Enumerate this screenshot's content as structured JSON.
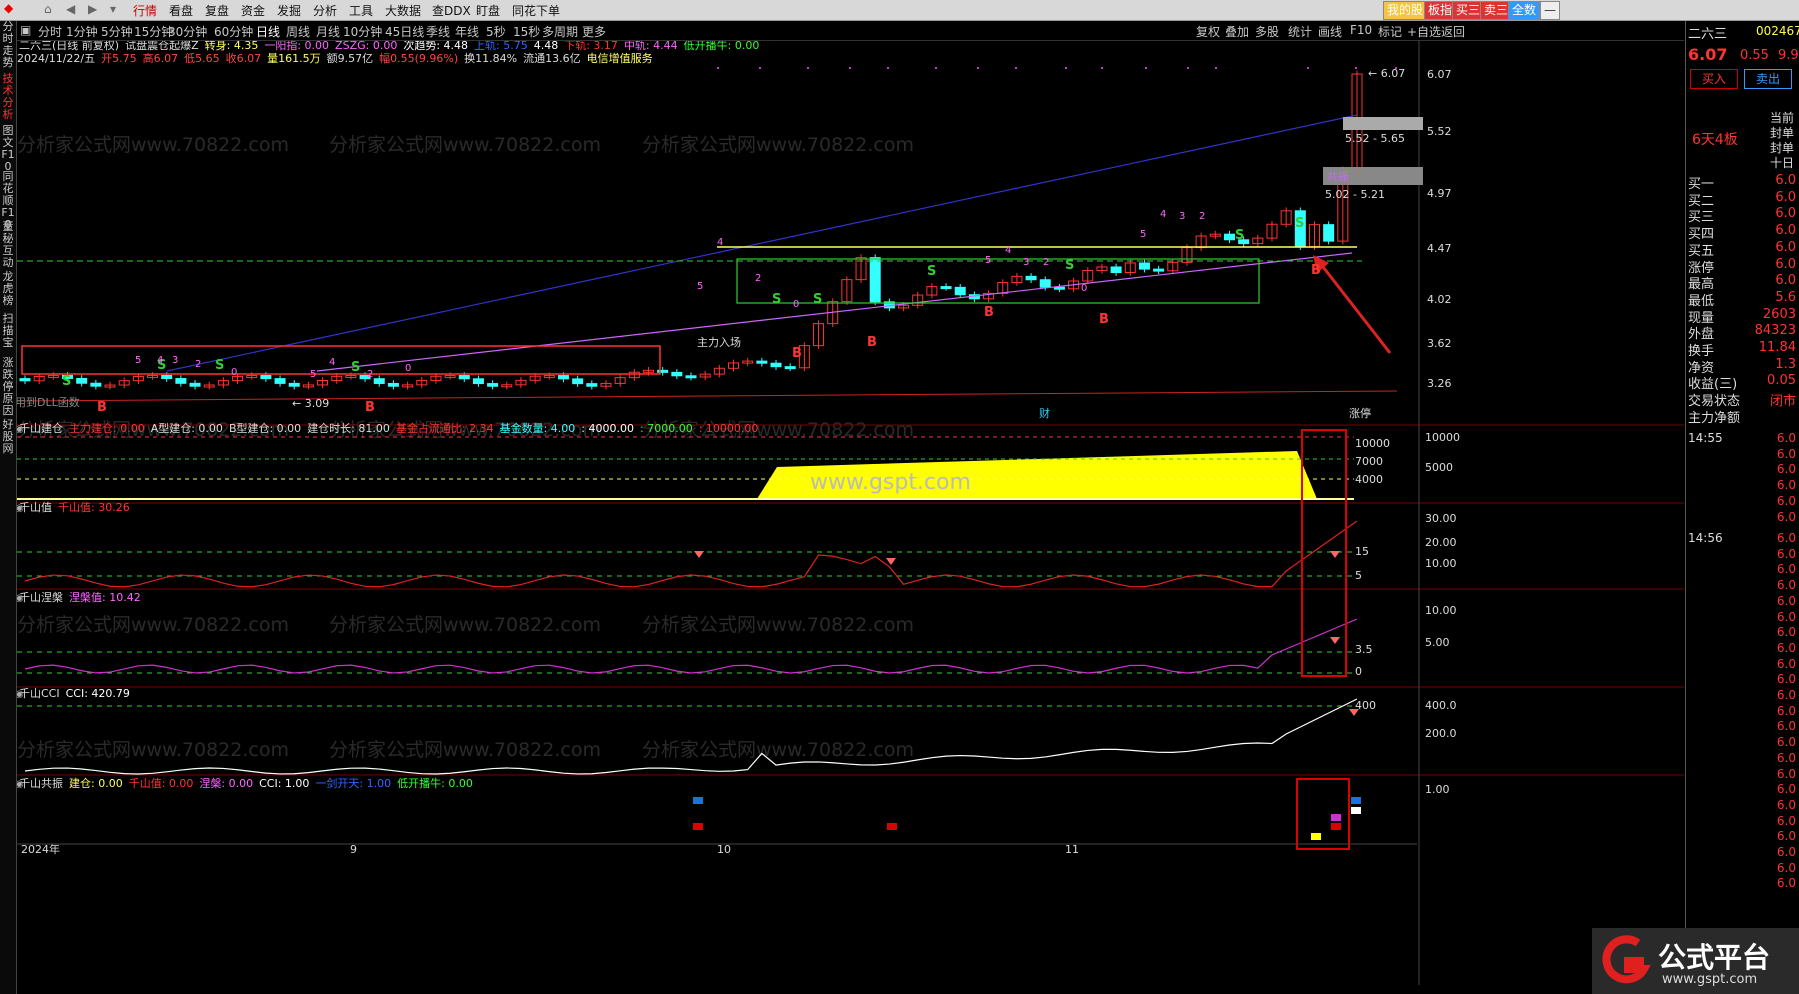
{
  "toolbar": {
    "items": [
      "行情",
      "看盘",
      "复盘",
      "资金",
      "发掘",
      "分析",
      "工具",
      "大数据",
      "查DDX",
      "盯盘",
      "同花下单"
    ],
    "active_index": 0,
    "right_buttons": [
      "我的股",
      "板指",
      "买三",
      "卖三",
      "全数"
    ]
  },
  "periods": {
    "items": [
      "分时",
      "1分钟",
      "5分钟",
      "15分钟",
      "30分钟",
      "60分钟",
      "日线",
      "周线",
      "月线",
      "10分钟",
      "45日线",
      "季线",
      "年线",
      "5秒",
      "15秒",
      "多周期",
      "更多"
    ],
    "active_index": 6,
    "right_tools": [
      "复权",
      "叠加",
      "多股",
      "统计",
      "画线",
      "F10",
      "标记",
      "+自选",
      "返回"
    ]
  },
  "leftbar": [
    "分时走势",
    "技术分析",
    "图文F10",
    "同花顺F10",
    "董秘互动",
    "龙虎榜",
    "扫描宝",
    "涨跌停原因",
    "好股网"
  ],
  "leftbar_active": 1,
  "stock": {
    "name": "二六三",
    "code": "002467",
    "price": "6.07",
    "change": "0.55",
    "change_pct": "9.9",
    "buy_label": "买入",
    "sell_label": "卖出"
  },
  "main_header": {
    "line1": [
      {
        "t": "二六三(日线 前复权)",
        "c": "#dddddd"
      },
      {
        "t": "试盘震仓起爆Z",
        "c": "#dddddd"
      },
      {
        "t": "转身: 4.35",
        "c": "#ffff66"
      },
      {
        "t": "一阳指: 0.00",
        "c": "#ff66ff"
      },
      {
        "t": "ZSZG: 0.00",
        "c": "#ff66ff"
      },
      {
        "t": "次趋势: 4.48",
        "c": "#ffffff"
      },
      {
        "t": "上轨: 5.75",
        "c": "#3366ff"
      },
      {
        "t": "4.48",
        "c": "#ffffff"
      },
      {
        "t": "下轨: 3.17",
        "c": "#ff3333"
      },
      {
        "t": "中轨: 4.44",
        "c": "#ff66ff"
      },
      {
        "t": "低开播牛: 0.00",
        "c": "#33ff33"
      }
    ],
    "line2": [
      {
        "t": "2024/11/22/五",
        "c": "#dddddd"
      },
      {
        "t": "开5.75",
        "c": "#ff4444"
      },
      {
        "t": "高6.07",
        "c": "#ff4444"
      },
      {
        "t": "低5.65",
        "c": "#ff4444"
      },
      {
        "t": "收6.07",
        "c": "#ff4444"
      },
      {
        "t": "量161.5万",
        "c": "#ffff66"
      },
      {
        "t": "额9.57亿",
        "c": "#dddddd"
      },
      {
        "t": "幅0.55(9.96%)",
        "c": "#ff4444"
      },
      {
        "t": "换11.84%",
        "c": "#dddddd"
      },
      {
        "t": "流通13.6亿",
        "c": "#dddddd"
      },
      {
        "t": "电信增值服务",
        "c": "#ffff66"
      }
    ]
  },
  "price_axis": [
    "6.07",
    "5.52",
    "4.97",
    "4.47",
    "4.02",
    "3.62",
    "3.26"
  ],
  "annotations": {
    "zone1": "5.52 - 5.65",
    "zone2": "5.02 - 5.21",
    "zone2_tag": "共振",
    "main_force": "主力入场",
    "low_label": "3.09",
    "high_label": "6.07",
    "board_count": "6天4板",
    "dll_note": "用到DLL函数",
    "cai": "财",
    "zhangting": "涨停"
  },
  "panel1": {
    "header": [
      {
        "t": "千山建仓",
        "c": "#dddddd"
      },
      {
        "t": "主力建仓: 0.00",
        "c": "#ff3333"
      },
      {
        "t": "A型建仓: 0.00",
        "c": "#dddddd"
      },
      {
        "t": "B型建仓: 0.00",
        "c": "#dddddd"
      },
      {
        "t": "建仓时长: 81.00",
        "c": "#dddddd"
      },
      {
        "t": "基金占流通比: 2.34",
        "c": "#ff3333"
      },
      {
        "t": "基金数量: 4.00",
        "c": "#33ffff"
      },
      {
        "t": ": 4000.00",
        "c": "#ffffff"
      },
      {
        "t": ": 7000.00",
        "c": "#33ff33"
      },
      {
        "t": ": 10000.00",
        "c": "#ff3333"
      }
    ],
    "axis": [
      "10000",
      "5000"
    ],
    "inner_labels": [
      "10000",
      "7000",
      "4000"
    ]
  },
  "panel2": {
    "header": [
      {
        "t": "千山值",
        "c": "#dddddd"
      },
      {
        "t": "千山值: 30.26",
        "c": "#ff3333"
      }
    ],
    "axis": [
      "30.00",
      "20.00",
      "10.00"
    ],
    "inner_labels": [
      "15",
      "5"
    ]
  },
  "panel3": {
    "header": [
      {
        "t": "千山涅槃",
        "c": "#dddddd"
      },
      {
        "t": "涅槃值: 10.42",
        "c": "#ff66ff"
      }
    ],
    "axis": [
      "10.00",
      "5.00"
    ],
    "inner_labels": [
      "3.5",
      "0"
    ]
  },
  "panel4": {
    "header": [
      {
        "t": "千山CCI",
        "c": "#dddddd"
      },
      {
        "t": "CCI: 420.79",
        "c": "#ffffff"
      }
    ],
    "axis": [
      "400.0",
      "200.0"
    ],
    "inner_labels": [
      "400"
    ]
  },
  "panel5": {
    "header": [
      {
        "t": "千山共振",
        "c": "#dddddd"
      },
      {
        "t": "建仓: 0.00",
        "c": "#ffff66"
      },
      {
        "t": "千山值: 0.00",
        "c": "#ff3333"
      },
      {
        "t": "涅槃: 0.00",
        "c": "#ff66ff"
      },
      {
        "t": "CCI: 1.00",
        "c": "#ffffff"
      },
      {
        "t": "一剑开天: 1.00",
        "c": "#3366ff"
      },
      {
        "t": "低开播牛: 0.00",
        "c": "#33ff33"
      }
    ],
    "axis": [
      "1.00"
    ]
  },
  "date_axis": [
    "2024年",
    "9",
    "10",
    "11"
  ],
  "watermark": "分析家公式网www.70822.com",
  "center_mark": "www.gspt.com",
  "right_panel": {
    "board_status": [
      "当前",
      "封单",
      "封单",
      "十日"
    ],
    "order_book": [
      {
        "k": "买一",
        "v": "6.0"
      },
      {
        "k": "买二",
        "v": "6.0"
      },
      {
        "k": "买三",
        "v": "6.0"
      },
      {
        "k": "买四",
        "v": "6.0"
      },
      {
        "k": "买五",
        "v": "6.0"
      },
      {
        "k": "涨停",
        "v": "6.0"
      },
      {
        "k": "最高",
        "v": "6.0"
      },
      {
        "k": "最低",
        "v": "5.6"
      },
      {
        "k": "现量",
        "v": "2603"
      },
      {
        "k": "外盘",
        "v": "84323"
      },
      {
        "k": "换手",
        "v": "11.84"
      },
      {
        "k": "净资",
        "v": "1.3"
      },
      {
        "k": "收益(三)",
        "v": "0.05"
      },
      {
        "k": "交易状态",
        "v": "闭市"
      },
      {
        "k": "主力净额",
        "v": ""
      }
    ],
    "ticks": [
      {
        "time": "14:55",
        "vals": [
          "6.0",
          "6.0",
          "6.0",
          "6.0",
          "6.0",
          "6.0"
        ]
      },
      {
        "time": "14:56",
        "vals": [
          "6.0",
          "6.0",
          "6.0",
          "6.0",
          "6.0",
          "6.0",
          "6.0",
          "6.0",
          "6.0",
          "6.0",
          "6.0",
          "6.0",
          "6.0",
          "6.0",
          "6.0",
          "6.0",
          "6.0",
          "6.0",
          "6.0",
          "6.0",
          "6.0",
          "6.0",
          "6.0"
        ]
      }
    ]
  },
  "logo": {
    "text": "公式平台",
    "sub": "www.gspt.com"
  },
  "colors": {
    "up": "#ff3333",
    "down": "#33ffff",
    "bg": "#000000",
    "accent_red": "#d00000"
  }
}
